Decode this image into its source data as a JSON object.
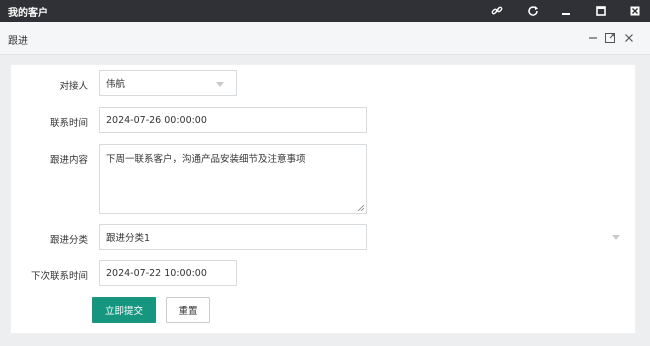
{
  "app": {
    "title": "我的客户"
  },
  "dialog": {
    "title": "跟进"
  },
  "form": {
    "contact_label": "对接人",
    "contact_value": "伟航",
    "contact_time_label": "联系时间",
    "contact_time_value": "2024-07-26 00:00:00",
    "content_label": "跟进内容",
    "content_value": "下周一联系客户，沟通产品安装细节及注意事项",
    "category_label": "跟进分类",
    "category_value": "跟进分类1",
    "next_time_label": "下次联系时间",
    "next_time_value": "2024-07-22 10:00:00",
    "submit_label": "立即提交",
    "reset_label": "重置"
  },
  "icons": {
    "topbar": [
      "link-icon",
      "refresh-icon",
      "minimize-icon",
      "maximize-icon",
      "close-icon"
    ],
    "dialog": [
      "minimize-icon",
      "expand-icon",
      "close-icon"
    ]
  },
  "colors": {
    "topbar": "#2f3136",
    "primary": "#16967f"
  }
}
